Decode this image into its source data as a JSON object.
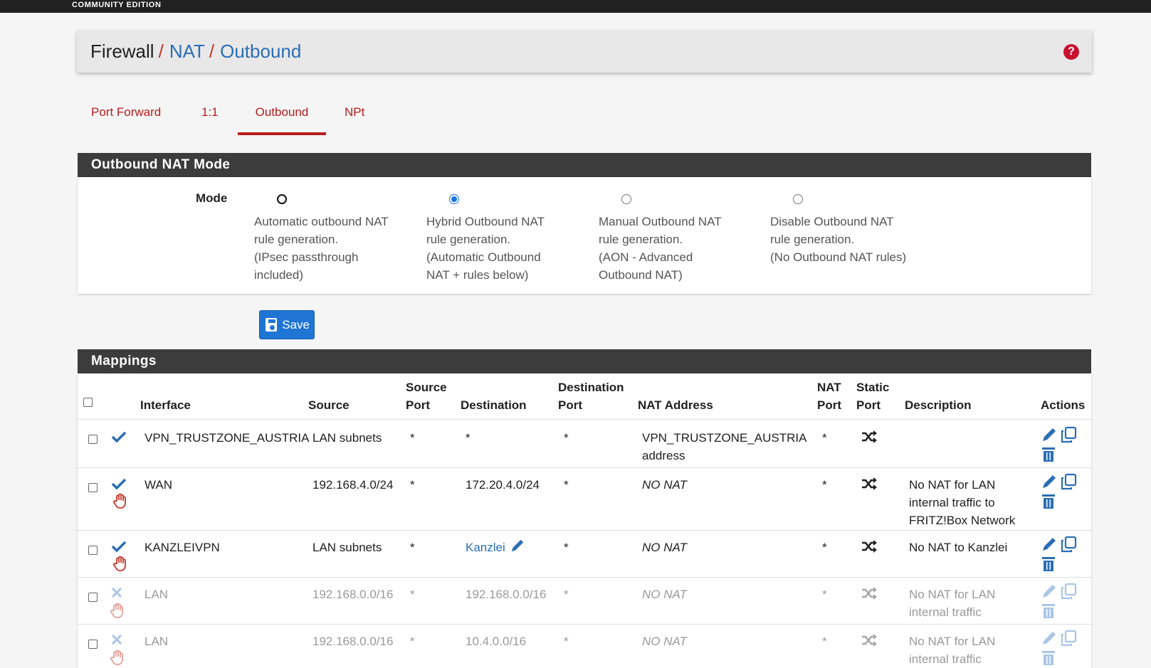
{
  "brand": {
    "edition": "COMMUNITY EDITION"
  },
  "breadcrumb": {
    "items": [
      "Firewall",
      "NAT",
      "Outbound"
    ],
    "separator": "/"
  },
  "tabs": [
    {
      "label": "Port Forward",
      "active": false
    },
    {
      "label": "1:1",
      "active": false
    },
    {
      "label": "Outbound",
      "active": true
    },
    {
      "label": "NPt",
      "active": false
    }
  ],
  "mode_panel": {
    "title": "Outbound NAT Mode",
    "label": "Mode",
    "options": [
      {
        "lines": [
          "Automatic outbound NAT",
          "rule generation.",
          "(IPsec passthrough",
          "included)"
        ],
        "checked": false
      },
      {
        "lines": [
          "Hybrid Outbound NAT",
          "rule generation.",
          "(Automatic Outbound",
          "NAT + rules below)"
        ],
        "checked": true
      },
      {
        "lines": [
          "Manual Outbound NAT",
          "rule generation.",
          "(AON - Advanced",
          "Outbound NAT)"
        ],
        "checked": false
      },
      {
        "lines": [
          "Disable Outbound NAT",
          "rule generation.",
          "(No Outbound NAT rules)"
        ],
        "checked": false
      }
    ],
    "save_label": "Save"
  },
  "mappings": {
    "title": "Mappings",
    "headers": {
      "interface": "Interface",
      "source": "Source",
      "source_port": [
        "Source",
        "Port"
      ],
      "destination": "Destination",
      "destination_port": [
        "Destination",
        "Port"
      ],
      "nat_address": "NAT Address",
      "nat_port": [
        "NAT",
        "Port"
      ],
      "static_port": [
        "Static",
        "Port"
      ],
      "description": "Description",
      "actions": "Actions"
    },
    "rows": [
      {
        "enabled": true,
        "no_nat_hand": false,
        "interface": "VPN_TRUSTZONE_AUSTRIA",
        "source": "LAN subnets",
        "source_port": "*",
        "destination": "*",
        "destination_port": "*",
        "nat_address": [
          "VPN_TRUSTZONE_AUSTRIA",
          "address"
        ],
        "nat_port": "*",
        "description": []
      },
      {
        "enabled": true,
        "no_nat_hand": true,
        "interface": "WAN",
        "source": "192.168.4.0/24",
        "source_port": "*",
        "destination": "172.20.4.0/24",
        "destination_port": "*",
        "nat_address": [
          "NO NAT"
        ],
        "nat_port": "*",
        "description": [
          "No NAT for LAN",
          "internal traffic to",
          "FRITZ!Box Network"
        ]
      },
      {
        "enabled": true,
        "no_nat_hand": true,
        "interface": "KANZLEIVPN",
        "source": "LAN subnets",
        "source_port": "*",
        "destination": "Kanzlei",
        "destination_port": "*",
        "nat_address": [
          "NO NAT"
        ],
        "nat_port": "*",
        "description": [
          "No NAT to Kanzlei"
        ]
      },
      {
        "enabled": false,
        "no_nat_hand": true,
        "interface": "LAN",
        "source": "192.168.0.0/16",
        "source_port": "*",
        "destination": "192.168.0.0/16",
        "destination_port": "*",
        "nat_address": [
          "NO NAT"
        ],
        "nat_port": "*",
        "description": [
          "No NAT for LAN",
          "internal traffic"
        ]
      },
      {
        "enabled": false,
        "no_nat_hand": true,
        "interface": "LAN",
        "source": "192.168.0.0/16",
        "source_port": "*",
        "destination": "10.4.0.0/16",
        "destination_port": "*",
        "nat_address": [
          "NO NAT"
        ],
        "nat_port": "*",
        "description": [
          "No NAT for LAN",
          "internal traffic"
        ]
      }
    ]
  },
  "colors": {
    "accent_red": "#b71c1c",
    "link_blue": "#2a6eb5",
    "header_dark": "#3c3c3c",
    "button_blue": "#1e75d4"
  }
}
